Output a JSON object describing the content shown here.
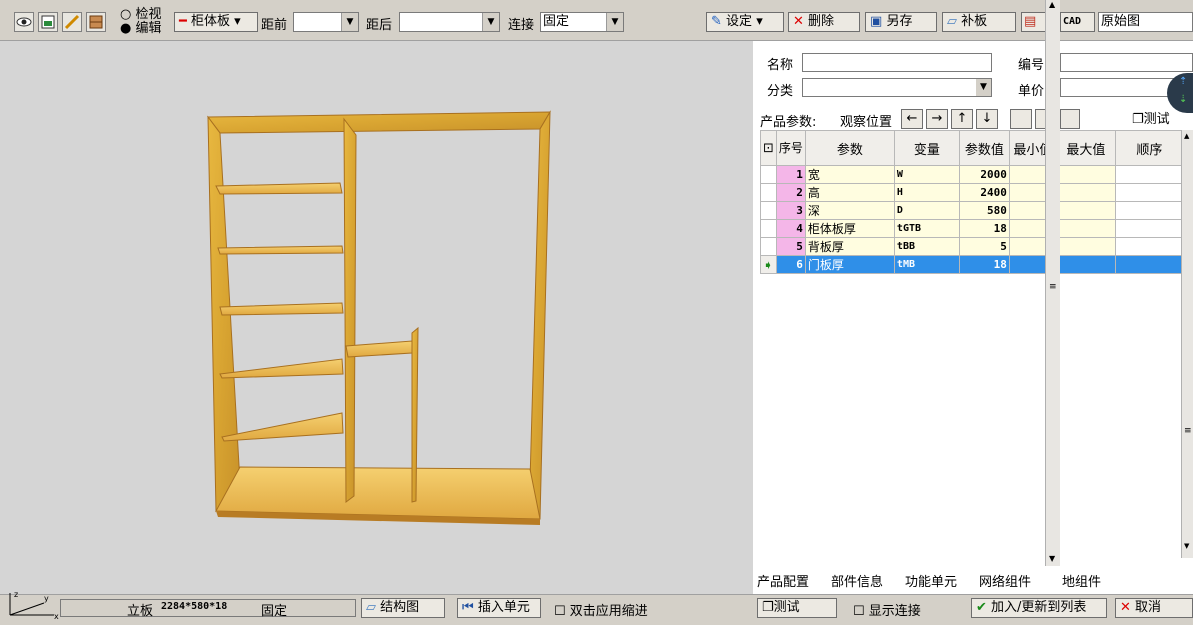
{
  "toolbar": {
    "mode_view": "检视",
    "mode_edit": "编辑",
    "board_type": "柜体板",
    "dist_front_label": "距前",
    "dist_back_label": "距后",
    "connect_label": "连接",
    "connect_value": "固定",
    "settings_label": "设定",
    "delete_label": "删除",
    "saveas_label": "另存",
    "patch_label": "补板",
    "cad_label": "CAD",
    "view_value": "原始图"
  },
  "product_form": {
    "name_label": "名称",
    "code_label": "编号",
    "category_label": "分类",
    "price_label": "单价",
    "params_label": "产品参数:",
    "observe_label": "观察位置",
    "arrows": [
      "←",
      "→",
      "↑",
      "↓"
    ],
    "test_label": "测试"
  },
  "param_table": {
    "headers": [
      "序号",
      "参数",
      "变量",
      "参数值",
      "最小值",
      "最大值",
      "顺序"
    ],
    "rows": [
      {
        "no": "1",
        "name": "宽",
        "var": "W",
        "value": "2000"
      },
      {
        "no": "2",
        "name": "高",
        "var": "H",
        "value": "2400"
      },
      {
        "no": "3",
        "name": "深",
        "var": "D",
        "value": "580"
      },
      {
        "no": "4",
        "name": "柜体板厚",
        "var": "tGTB",
        "value": "18"
      },
      {
        "no": "5",
        "name": "背板厚",
        "var": "tBB",
        "value": "5"
      },
      {
        "no": "6",
        "name": "门板厚",
        "var": "tMB",
        "value": "18"
      }
    ]
  },
  "tabs": [
    "产品配置",
    "部件信息",
    "功能单元",
    "网络组件",
    "地组件"
  ],
  "status": {
    "part_text": "立板",
    "part_size": "2284*580*18",
    "part_mode": "固定",
    "structure_btn": "结构图",
    "insert_btn": "插入单元",
    "dblclick_label": "双击应用缩进",
    "test_btn": "测试",
    "show_conn_label": "显示连接",
    "add_btn": "加入/更新到列表",
    "cancel_btn": "取消"
  },
  "axis": {
    "z": "z",
    "y": "y",
    "x": "x"
  }
}
